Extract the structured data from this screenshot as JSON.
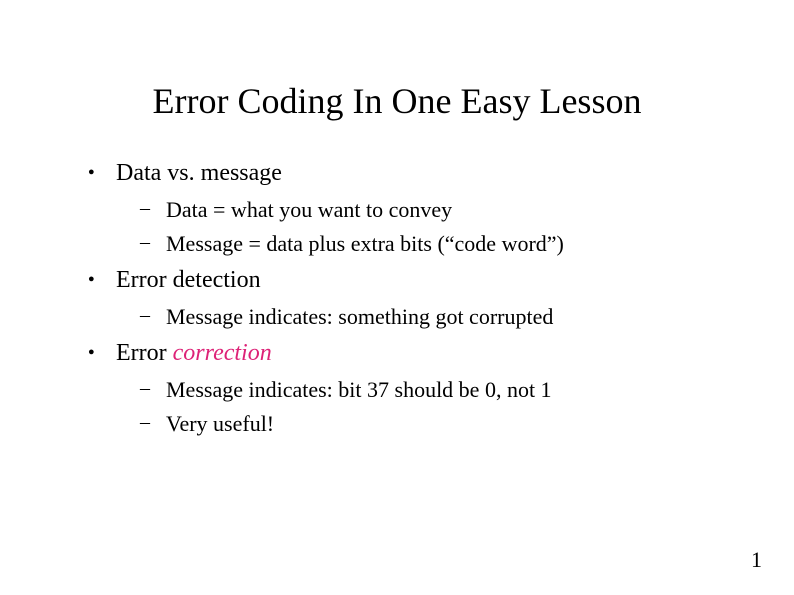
{
  "title": "Error Coding In One Easy Lesson",
  "bullets": [
    {
      "label": "Data vs. message",
      "subs": [
        "Data = what you want to convey",
        "Message = data plus extra bits (“code word”)"
      ]
    },
    {
      "label": "Error detection",
      "subs": [
        "Message indicates: something got corrupted"
      ]
    },
    {
      "label_prefix": "Error ",
      "label_emph": "correction",
      "subs": [
        "Message indicates: bit 37 should be 0, not 1",
        "Very useful!"
      ]
    }
  ],
  "page_number": "1"
}
